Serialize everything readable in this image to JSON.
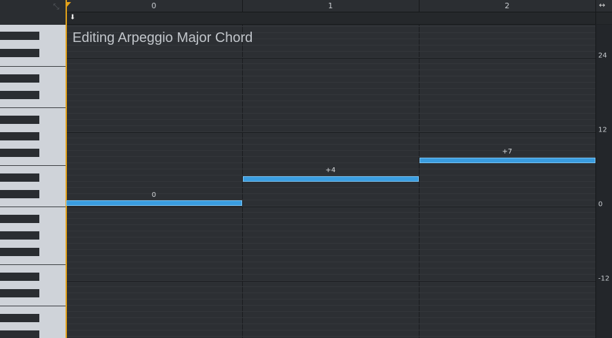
{
  "editor": {
    "title": "Editing Arpeggio Major Chord",
    "ruler_labels": [
      "0",
      "1",
      "2"
    ],
    "y_axis_labels": [
      "24",
      "12",
      "0",
      "-12"
    ],
    "accent_color": "#e3a21a",
    "note_color": "#3a9de0"
  },
  "notes": [
    {
      "step": 0,
      "semitone": 0,
      "label": "0"
    },
    {
      "step": 1,
      "semitone": 4,
      "label": "+4"
    },
    {
      "step": 2,
      "semitone": 7,
      "label": "+7"
    }
  ],
  "icons": {
    "expand": "expand-icon",
    "down_arrow": "down-arrow-icon",
    "fit_width": "fit-width-icon"
  }
}
